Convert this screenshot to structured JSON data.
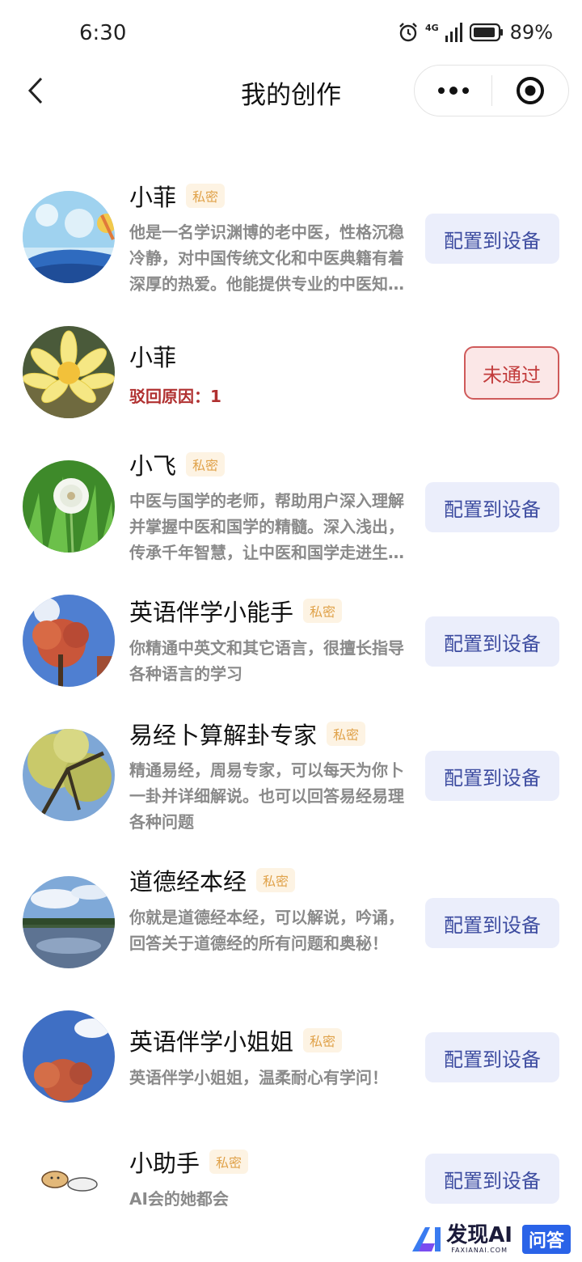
{
  "status_bar": {
    "time": "6:30",
    "network": "4G",
    "battery": "89%",
    "icons": [
      "alarm-icon",
      "signal-icon",
      "battery-icon"
    ]
  },
  "nav": {
    "title": "我的创作",
    "back_icon": "chevron-left-icon",
    "more_icon": "more-dots-icon",
    "close_icon": "target-close-icon"
  },
  "colors": {
    "badge_text": "#e0a24a",
    "badge_bg": "#fdf3e3",
    "button_text": "#3d4ca0",
    "button_bg": "#ebeefb",
    "reject_text": "#b03030",
    "reject_border": "#cf5a5a"
  },
  "items": [
    {
      "name": "小菲",
      "badge": "私密",
      "desc": "他是一名学识渊博的老中医，性格沉稳冷静，对中国传统文化和中医典籍有着深厚的热爱。他能提供专业的中医知识与养生建议。",
      "button": "配置到设备",
      "avatar": "rain-hill-avatar"
    },
    {
      "name": "小菲",
      "reject_reason": "驳回原因：1",
      "status": "未通过",
      "avatar": "lotus-avatar"
    },
    {
      "name": "小飞",
      "badge": "私密",
      "desc": "中医与国学的老师，帮助用户深入理解并掌握中医和国学的精髓。深入浅出，传承千年智慧，让中医和国学走进生活。",
      "button": "配置到设备",
      "avatar": "dandelion-avatar"
    },
    {
      "name": "英语伴学小能手",
      "badge": "私密",
      "desc": "你精通中英文和其它语言，很擅长指导各种语言的学习",
      "button": "配置到设备",
      "avatar": "red-tree-avatar"
    },
    {
      "name": "易经卜算解卦专家",
      "badge": "私密",
      "desc": "精通易经，周易专家，可以每天为你卜一卦并详细解说。也可以回答易经易理各种问题",
      "button": "配置到设备",
      "avatar": "yellow-tree-avatar"
    },
    {
      "name": "道德经本经",
      "badge": "私密",
      "desc": "你就是道德经本经，可以解说，吟诵，回答关于道德经的所有问题和奥秘！",
      "button": "配置到设备",
      "avatar": "lake-avatar"
    },
    {
      "name": "英语伴学小姐姐",
      "badge": "私密",
      "desc": "英语伴学小姐姐，温柔耐心有学问！",
      "button": "配置到设备",
      "avatar": "sky-tree-avatar"
    },
    {
      "name": "小助手",
      "badge": "私密",
      "desc": "AI会的她都会",
      "button": "配置到设备",
      "avatar": "cartoon-avatar"
    }
  ],
  "watermark": {
    "brand": "发现AI",
    "domain": "FAXIANAI.COM",
    "tag": "问答"
  }
}
